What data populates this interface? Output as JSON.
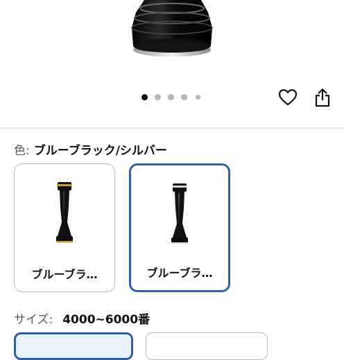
{
  "color": {
    "key": "色:",
    "value": "ブルーブラック/シルバー"
  },
  "swatches": [
    {
      "label": "ブルーブラ…",
      "selected": false
    },
    {
      "label": "ブルーブラ…",
      "selected": true
    }
  ],
  "size": {
    "key": "サイズ:",
    "value": "4000~6000番"
  },
  "carousel": {
    "total": 5,
    "active": 1
  },
  "accent": "#2f5fa5"
}
